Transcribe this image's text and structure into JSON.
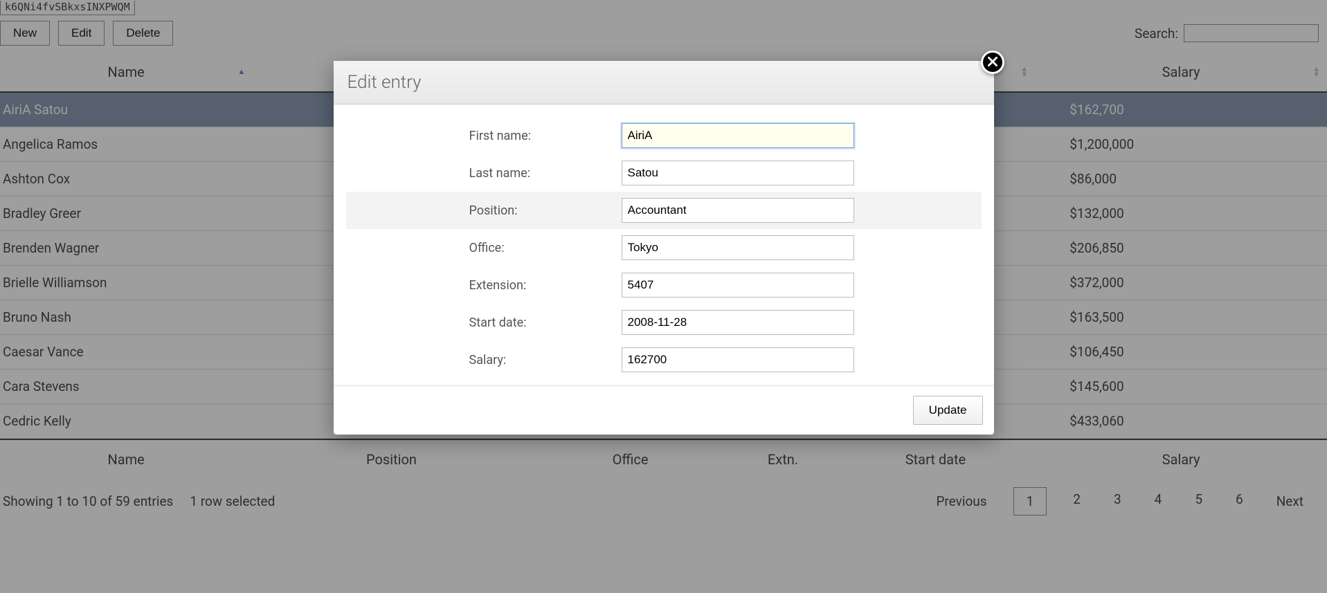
{
  "top_code": "k6QNi4fvSBkxsINXPWQM",
  "toolbar": {
    "new_label": "New",
    "edit_label": "Edit",
    "delete_label": "Delete"
  },
  "search": {
    "label": "Search:",
    "value": ""
  },
  "columns": {
    "name": "Name",
    "position": "Position",
    "office": "Office",
    "extn": "Extn.",
    "start_date": "Start date",
    "salary": "Salary"
  },
  "rows": [
    {
      "name": "AiriA Satou",
      "salary": "$162,700",
      "selected": true
    },
    {
      "name": "Angelica Ramos",
      "salary": "$1,200,000",
      "selected": false
    },
    {
      "name": "Ashton Cox",
      "salary": "$86,000",
      "selected": false
    },
    {
      "name": "Bradley Greer",
      "salary": "$132,000",
      "selected": false
    },
    {
      "name": "Brenden Wagner",
      "salary": "$206,850",
      "selected": false
    },
    {
      "name": "Brielle Williamson",
      "salary": "$372,000",
      "selected": false
    },
    {
      "name": "Bruno Nash",
      "salary": "$163,500",
      "selected": false
    },
    {
      "name": "Caesar Vance",
      "salary": "$106,450",
      "selected": false
    },
    {
      "name": "Cara Stevens",
      "salary": "$145,600",
      "selected": false
    },
    {
      "name": "Cedric Kelly",
      "salary": "$433,060",
      "selected": false
    }
  ],
  "info": {
    "showing": "Showing 1 to 10 of 59 entries",
    "selected": "1 row selected"
  },
  "pagination": {
    "previous": "Previous",
    "next": "Next",
    "pages": [
      "1",
      "2",
      "3",
      "4",
      "5",
      "6"
    ],
    "current": "1"
  },
  "modal": {
    "title": "Edit entry",
    "update_label": "Update",
    "fields": {
      "first_name": {
        "label": "First name:",
        "value": "AiriA"
      },
      "last_name": {
        "label": "Last name:",
        "value": "Satou"
      },
      "position": {
        "label": "Position:",
        "value": "Accountant"
      },
      "office": {
        "label": "Office:",
        "value": "Tokyo"
      },
      "extension": {
        "label": "Extension:",
        "value": "5407"
      },
      "start_date": {
        "label": "Start date:",
        "value": "2008-11-28"
      },
      "salary": {
        "label": "Salary:",
        "value": "162700"
      }
    }
  }
}
